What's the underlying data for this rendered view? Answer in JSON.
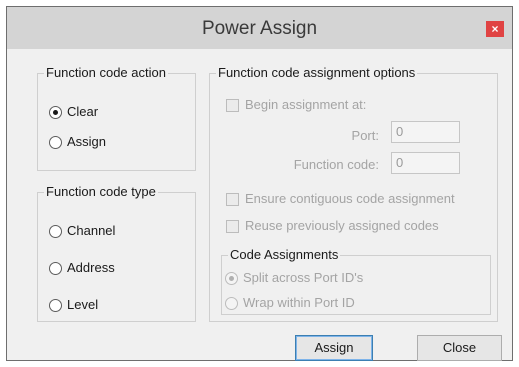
{
  "window": {
    "title": "Power Assign",
    "close_glyph": "×"
  },
  "action_group": {
    "legend": "Function code action",
    "options": [
      {
        "label": "Clear",
        "checked": true
      },
      {
        "label": "Assign",
        "checked": false
      }
    ]
  },
  "type_group": {
    "legend": "Function code type",
    "options": [
      {
        "label": "Channel",
        "checked": false
      },
      {
        "label": "Address",
        "checked": false
      },
      {
        "label": "Level",
        "checked": false
      }
    ]
  },
  "options_group": {
    "legend": "Function code assignment options",
    "begin_label": "Begin assignment at:",
    "port_label": "Port:",
    "port_value": "0",
    "function_code_label": "Function code:",
    "function_code_value": "0",
    "contiguous_label": "Ensure contiguous code assignment",
    "reuse_label": "Reuse previously assigned codes"
  },
  "code_assignments": {
    "legend": "Code Assignments",
    "split_label": "Split across Port ID's",
    "wrap_label": "Wrap within Port ID"
  },
  "buttons": {
    "assign": "Assign",
    "close": "Close"
  }
}
